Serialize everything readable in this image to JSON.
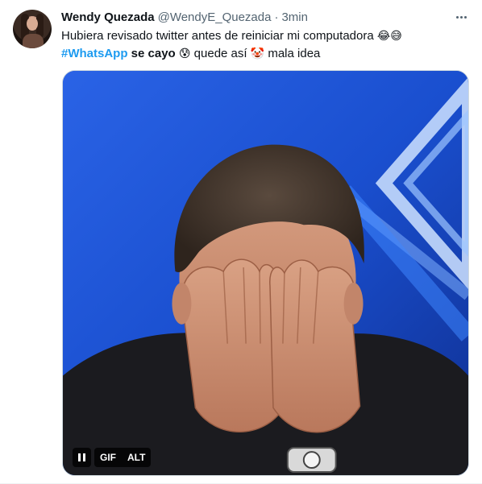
{
  "tweet": {
    "author_name": "Wendy Quezada",
    "author_handle": "@WendyE_Quezada",
    "separator": "·",
    "time": "3min",
    "text_line1": "Hubiera revisado twitter antes de reiniciar mi computadora",
    "line1_emojis": [
      "😂",
      "😅"
    ],
    "hashtag": "#WhatsApp",
    "text_bold": "se cayo",
    "emoji_anxious": "😰",
    "text_mid": "quede así",
    "emoji_clown": "🤡",
    "text_end": "mala idea"
  },
  "media": {
    "type": "gif",
    "pause_icon": "pause-icon",
    "gif_label": "GIF",
    "alt_label": "ALT"
  },
  "colors": {
    "hashtag": "#1d9bf0",
    "secondary_text": "#536471",
    "border": "#cfd9de",
    "gif_background": "#1a4fcf"
  }
}
